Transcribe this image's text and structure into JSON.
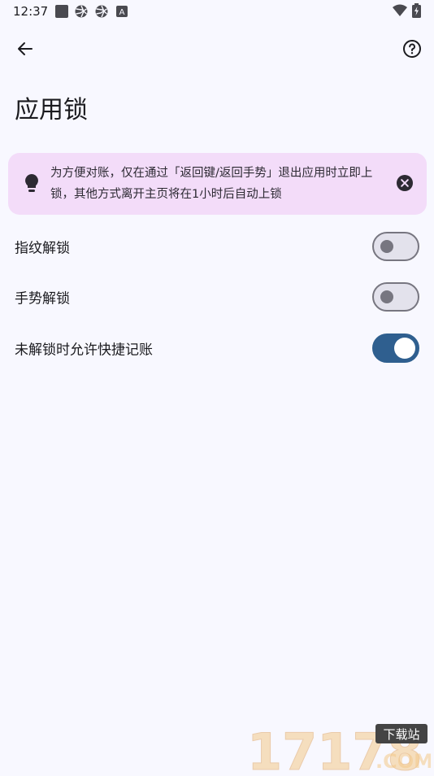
{
  "status_bar": {
    "time": "12:37",
    "left_icons": [
      "square-notification-icon",
      "aperture-icon",
      "aperture-icon",
      "a-letter-icon"
    ],
    "a_icon_letter": "A",
    "right_icons": [
      "wifi-icon",
      "battery-charging-icon"
    ]
  },
  "app_bar": {
    "back_icon": "arrow-left-icon",
    "help_icon": "help-circle-icon"
  },
  "page": {
    "title": "应用锁"
  },
  "tip": {
    "icon": "lightbulb-icon",
    "text": "为方便对账，仅在通过「返回键/返回手势」退出应用时立即上锁，其他方式离开主页将在1小时后自动上锁",
    "close_icon": "close-circle-icon"
  },
  "settings": [
    {
      "label": "指纹解锁",
      "enabled": false
    },
    {
      "label": "手势解锁",
      "enabled": false
    },
    {
      "label": "未解锁时允许快捷记账",
      "enabled": true
    }
  ],
  "watermark": {
    "number": "17178",
    "badge": "下载站",
    "suffix": ".COM"
  },
  "colors": {
    "background": "#f8f8ff",
    "tip_background": "#f3dcf9",
    "switch_on": "#2f5f8f",
    "switch_off_track": "#e3e2ec",
    "switch_off_outline": "#777680"
  }
}
